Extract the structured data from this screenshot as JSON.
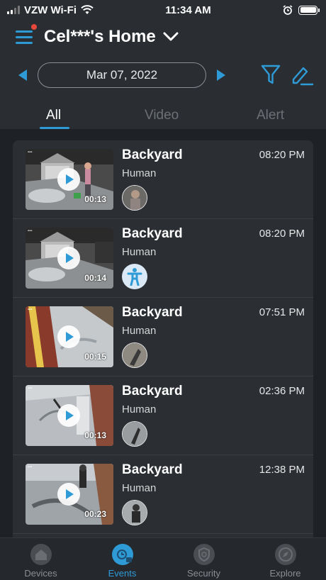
{
  "status_bar": {
    "carrier": "VZW Wi-Fi",
    "time": "11:34 AM"
  },
  "header": {
    "home_name": "Cel***'s Home"
  },
  "date_nav": {
    "date": "Mar 07, 2022"
  },
  "tabs": [
    {
      "label": "All",
      "active": true
    },
    {
      "label": "Video",
      "active": false
    },
    {
      "label": "Alert",
      "active": false
    }
  ],
  "events": [
    {
      "camera": "Backyard",
      "type": "Human",
      "time": "08:20 PM",
      "duration": "00:13"
    },
    {
      "camera": "Backyard",
      "type": "Human",
      "time": "08:20 PM",
      "duration": "00:14"
    },
    {
      "camera": "Backyard",
      "type": "Human",
      "time": "07:51 PM",
      "duration": "00:15"
    },
    {
      "camera": "Backyard",
      "type": "Human",
      "time": "02:36 PM",
      "duration": "00:13"
    },
    {
      "camera": "Backyard",
      "type": "Human",
      "time": "12:38 PM",
      "duration": "00:23"
    }
  ],
  "bottom_nav": [
    {
      "label": "Devices",
      "icon": "house-icon"
    },
    {
      "label": "Events",
      "icon": "events-icon"
    },
    {
      "label": "Security",
      "icon": "shield-icon"
    },
    {
      "label": "Explore",
      "icon": "compass-icon"
    }
  ],
  "colors": {
    "accent": "#2f9bd6",
    "background": "#2a2e33",
    "card": "#2b2f34",
    "notification_dot": "#e8473b"
  }
}
